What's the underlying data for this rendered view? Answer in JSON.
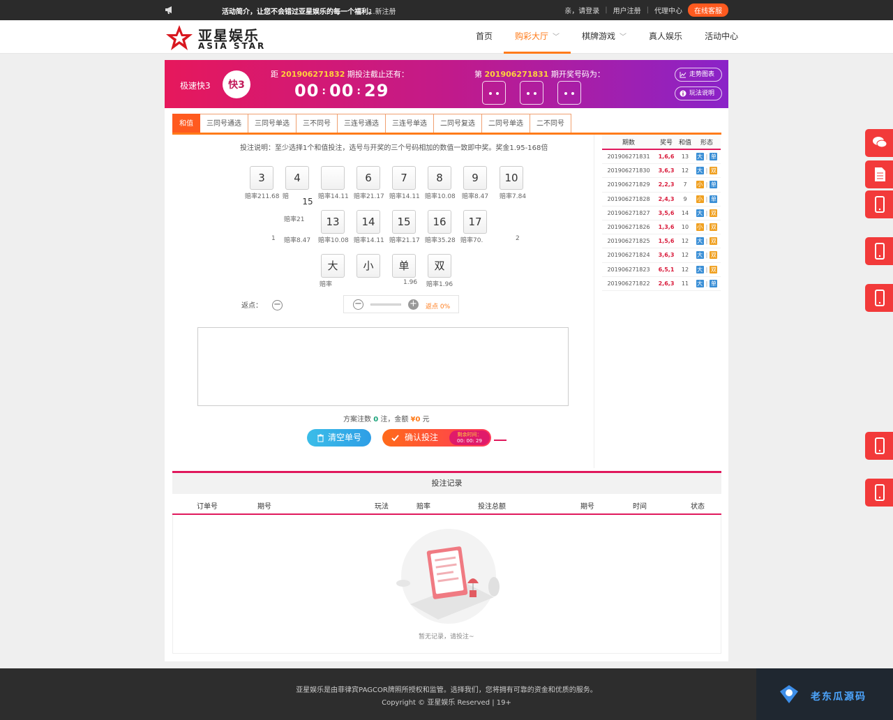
{
  "topbar": {
    "notice_title": "活动简介，让您不会错过亚星娱乐的每一个福利。",
    "notice_item": "1.新注册",
    "login": "亲，请登录",
    "register": "用户注册",
    "agent": "代理中心",
    "service": "在线客服"
  },
  "header": {
    "logo_cn": "亚星娱乐",
    "logo_en": "ASIA STAR",
    "nav": [
      "首页",
      "购彩大厅",
      "棋牌游戏",
      "真人娱乐",
      "活动中心"
    ]
  },
  "banner": {
    "game_name": "极速快3",
    "game_logo_text": "快3",
    "cur_prefix": "距",
    "cur_issue": "201906271832",
    "cur_suffix": "期投注截止还有：",
    "countdown": [
      "00",
      "00",
      "29"
    ],
    "last_prefix": "第",
    "last_issue": "201906271831",
    "last_suffix": "期开奖号码为：",
    "dice": [
      2,
      2,
      2
    ],
    "trend_btn": "走势图表",
    "rules_btn": "玩法说明"
  },
  "tabs": [
    "和值",
    "三同号通选",
    "三同号单选",
    "三不同号",
    "三连号通选",
    "三连号单选",
    "二同号复选",
    "二同号单选",
    "二不同号"
  ],
  "instruction": "投注说明：至少选择1个和值投注，选号与开奖的三个号码相加的数值一致即中奖。奖金1.95-168倍",
  "balls": {
    "row1": [
      {
        "num": "3",
        "odds": "赔率211.68"
      },
      {
        "num": "4",
        "odds": "赔"
      },
      {
        "num": "",
        "odds": "赔率14.11"
      },
      {
        "num": "6",
        "odds": "赔率21.17"
      },
      {
        "num": "7",
        "odds": "赔率14.11"
      },
      {
        "num": "8",
        "odds": "赔率10.08"
      },
      {
        "num": "9",
        "odds": "赔率8.47"
      },
      {
        "num": "10",
        "odds": "赔率7.84"
      }
    ],
    "row2": [
      {
        "num": "",
        "odds": "赔率8.47"
      },
      {
        "num": "13",
        "odds": "赔率10.08"
      },
      {
        "num": "14",
        "odds": "赔率14.11"
      },
      {
        "num": "15",
        "odds": "赔率21.17"
      },
      {
        "num": "16",
        "odds": "赔率35.28"
      },
      {
        "num": "17",
        "odds": "赔率70."
      }
    ],
    "row3": [
      {
        "num": "大",
        "odds": "赔率"
      },
      {
        "num": "小",
        "odds": ""
      },
      {
        "num": "单",
        "odds": "1.96"
      },
      {
        "num": "双",
        "odds": "赔率1.96"
      }
    ],
    "floating_num": "15",
    "floating_odds": "赔率21",
    "stray_1": "1",
    "stray_2": "2"
  },
  "rebate": {
    "label": "返点：",
    "value": "返点 0%"
  },
  "summary": {
    "prefix": "方案注数",
    "count": "0",
    "mid": "注，金额",
    "amount": "¥0",
    "suffix": "元"
  },
  "buttons": {
    "clear": "清空单号",
    "confirm": "确认投注",
    "cd_label": "剩余时间：",
    "cd_time": "00: 00: 29"
  },
  "history": {
    "headers": [
      "期数",
      "奖号",
      "和值",
      "形态"
    ],
    "rows": [
      {
        "issue": "201906271831",
        "nums": "1,6,6",
        "sum": "13",
        "size": "大",
        "parity": "单"
      },
      {
        "issue": "201906271830",
        "nums": "3,6,3",
        "sum": "12",
        "size": "大",
        "parity": "双"
      },
      {
        "issue": "201906271829",
        "nums": "2,2,3",
        "sum": "7",
        "size": "小",
        "parity": "单"
      },
      {
        "issue": "201906271828",
        "nums": "2,4,3",
        "sum": "9",
        "size": "小",
        "parity": "单"
      },
      {
        "issue": "201906271827",
        "nums": "3,5,6",
        "sum": "14",
        "size": "大",
        "parity": "双"
      },
      {
        "issue": "201906271826",
        "nums": "1,3,6",
        "sum": "10",
        "size": "小",
        "parity": "双"
      },
      {
        "issue": "201906271825",
        "nums": "1,5,6",
        "sum": "12",
        "size": "大",
        "parity": "双"
      },
      {
        "issue": "201906271824",
        "nums": "3,6,3",
        "sum": "12",
        "size": "大",
        "parity": "双"
      },
      {
        "issue": "201906271823",
        "nums": "6,5,1",
        "sum": "12",
        "size": "大",
        "parity": "双"
      },
      {
        "issue": "201906271822",
        "nums": "2,6,3",
        "sum": "11",
        "size": "大",
        "parity": "单"
      }
    ]
  },
  "records": {
    "title": "投注记录",
    "columns": [
      "订单号",
      "期号",
      "玩法",
      "赔率",
      "投注总额",
      "期号",
      "时间",
      "状态"
    ],
    "empty_text": "暂无记录，请投注~"
  },
  "footer": {
    "line1": "亚星娱乐是由菲律宾PAGCOR牌照所授权和监管。选择我们，您将拥有可靠的资金和优质的服务。",
    "line2": "Copyright © 亚星娱乐 Reserved | 19+"
  },
  "watermark": "老东瓜源码",
  "colors": {
    "accent": "#ff7b1a",
    "primary_red": "#e0185c",
    "banner_from": "#e6185c",
    "banner_to": "#8a23c8",
    "float": "#f23a3a",
    "tag_blue": "#3b8fd6",
    "tag_orange": "#f0a020"
  },
  "float_icons": [
    "chat-icon",
    "document-icon",
    "mobile-icon",
    "mobile-icon",
    "mobile-icon",
    "mobile-icon",
    "mobile-icon"
  ]
}
